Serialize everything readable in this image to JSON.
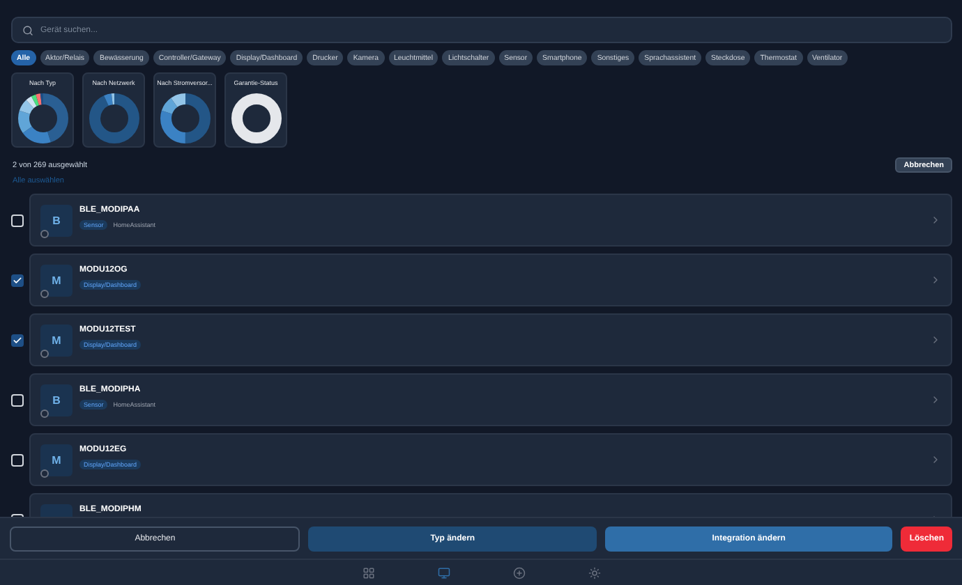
{
  "search": {
    "placeholder": "Gerät suchen..."
  },
  "filters": [
    {
      "label": "Alle",
      "selected": true
    },
    {
      "label": "Aktor/Relais",
      "selected": false
    },
    {
      "label": "Bewässerung",
      "selected": false
    },
    {
      "label": "Controller/Gateway",
      "selected": false
    },
    {
      "label": "Display/Dashboard",
      "selected": false
    },
    {
      "label": "Drucker",
      "selected": false
    },
    {
      "label": "Kamera",
      "selected": false
    },
    {
      "label": "Leuchtmittel",
      "selected": false
    },
    {
      "label": "Lichtschalter",
      "selected": false
    },
    {
      "label": "Sensor",
      "selected": false
    },
    {
      "label": "Smartphone",
      "selected": false
    },
    {
      "label": "Sonstiges",
      "selected": false
    },
    {
      "label": "Sprachassistent",
      "selected": false
    },
    {
      "label": "Steckdose",
      "selected": false
    },
    {
      "label": "Thermostat",
      "selected": false
    },
    {
      "label": "Ventilator",
      "selected": false
    }
  ],
  "charts": [
    {
      "title": "Nach Typ"
    },
    {
      "title": "Nach Netzwerk"
    },
    {
      "title": "Nach Stromversor..."
    },
    {
      "title": "Garantie-Status"
    }
  ],
  "selection": {
    "count": "2 von 269 ausgewählt",
    "cancel": "Abbrechen",
    "select_all": "Alle auswählen"
  },
  "devices": [
    {
      "name": "BLE_MODIPAA",
      "initial": "B",
      "checked": false,
      "type": "Sensor",
      "integration": "HomeAssistant"
    },
    {
      "name": "MODU12OG",
      "initial": "M",
      "checked": true,
      "type": "Display/Dashboard"
    },
    {
      "name": "MODU12TEST",
      "initial": "M",
      "checked": true,
      "type": "Display/Dashboard"
    },
    {
      "name": "BLE_MODIPHA",
      "initial": "B",
      "checked": false,
      "type": "Sensor",
      "integration": "HomeAssistant"
    },
    {
      "name": "MODU12EG",
      "initial": "M",
      "checked": false,
      "type": "Display/Dashboard"
    },
    {
      "name": "BLE_MODIPHM",
      "checked": false
    }
  ],
  "actions": [
    {
      "label": "Abbrechen",
      "kind": "outline"
    },
    {
      "label": "Typ ändern",
      "kind": "secondary"
    },
    {
      "label": "Integration ändern",
      "kind": "primary"
    },
    {
      "label": "Löschen",
      "kind": "danger"
    }
  ],
  "nav": [
    {
      "kind": "grid",
      "selected": false
    },
    {
      "kind": "monitor",
      "selected": true
    },
    {
      "kind": "add",
      "selected": false
    },
    {
      "kind": "settings",
      "selected": false
    }
  ]
}
